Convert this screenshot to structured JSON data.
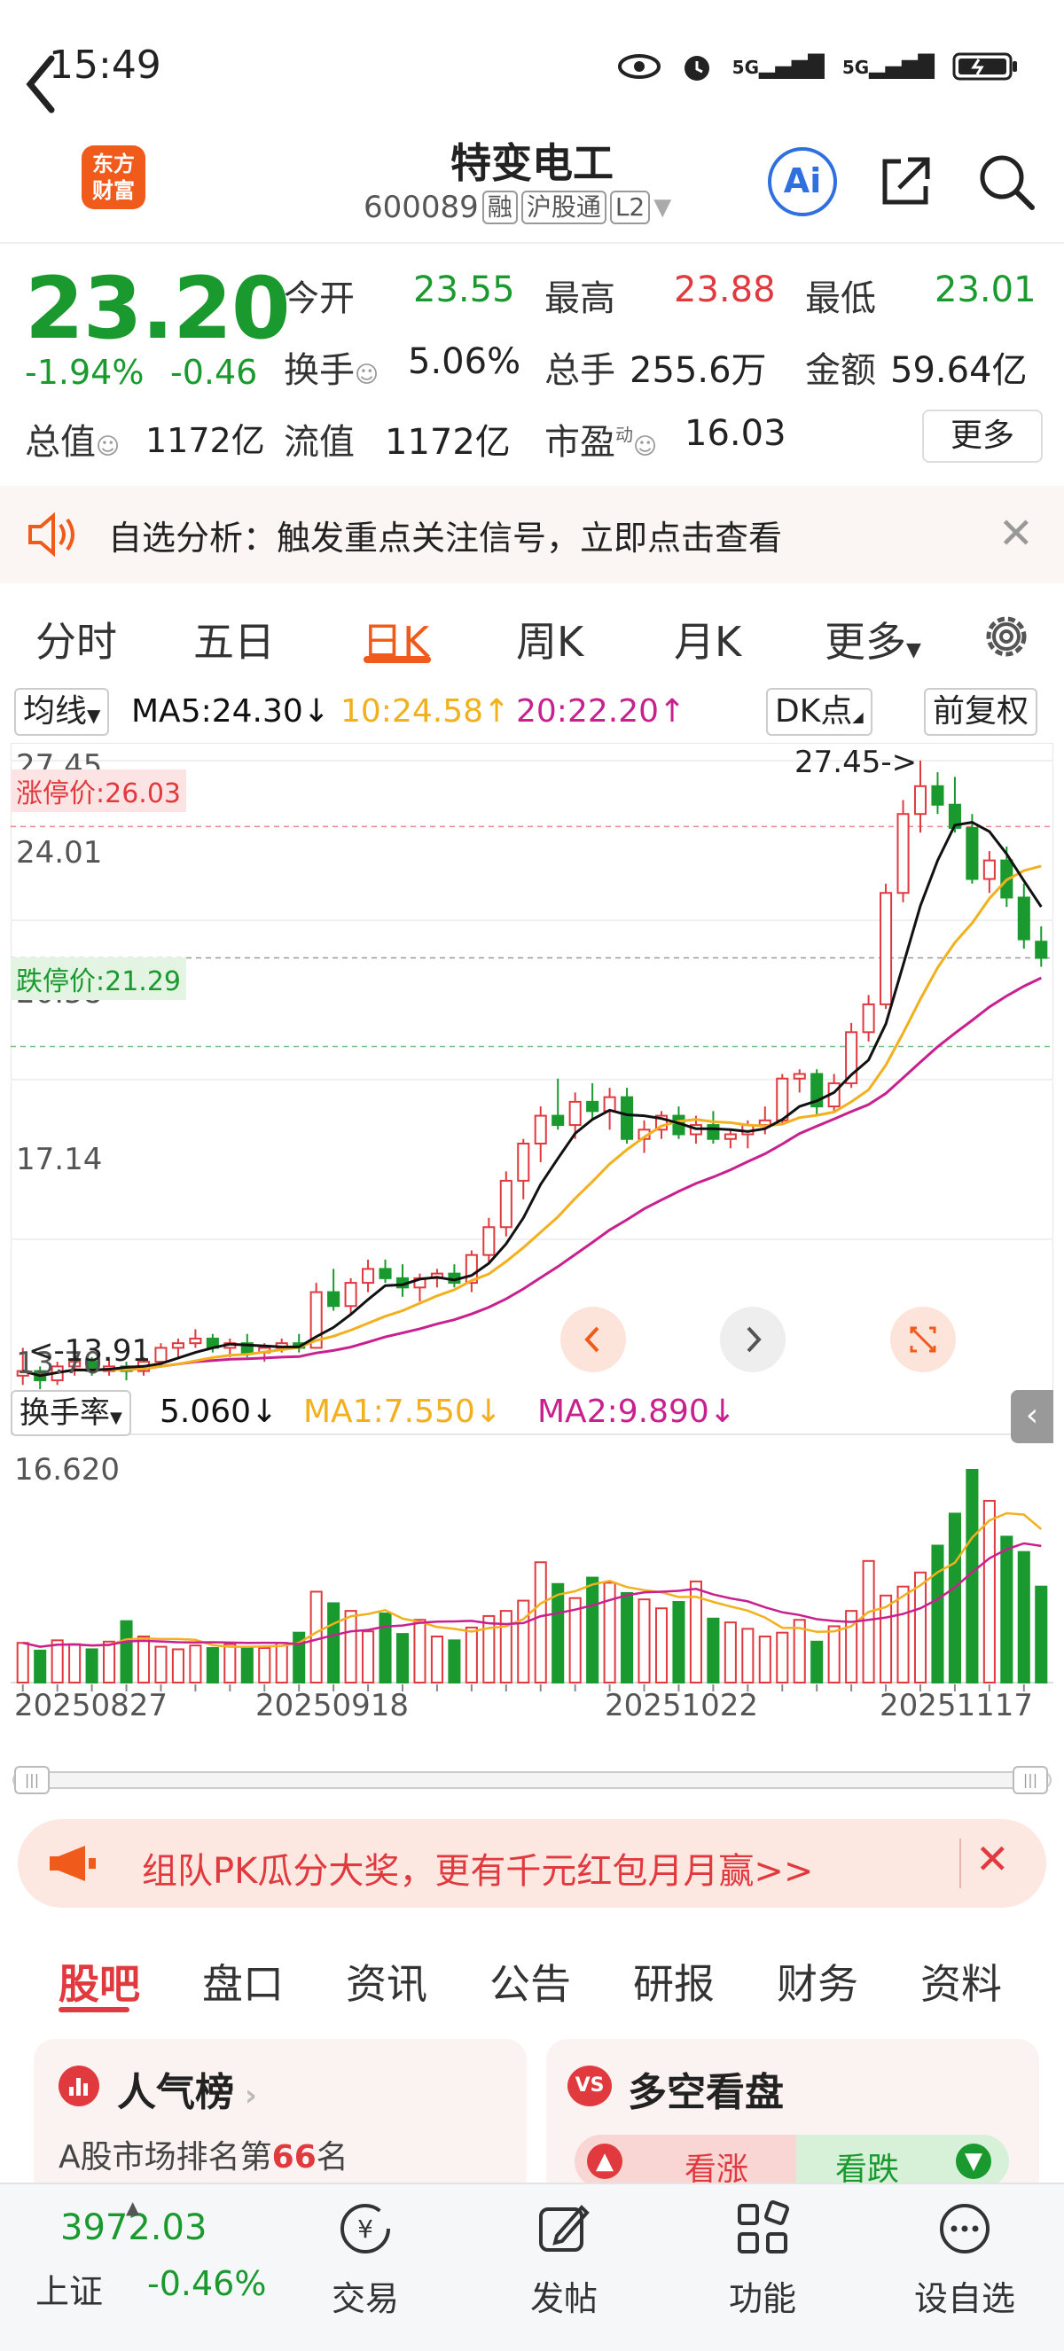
{
  "status_bar": {
    "time": "15:49",
    "net1": "5G",
    "net2": "5G"
  },
  "header": {
    "logo_text_1": "东方",
    "logo_text_2": "财富",
    "stock_name": "特变电工",
    "stock_code": "600089",
    "tags": [
      "融",
      "沪股通",
      "L2"
    ],
    "ai_label": "Ai"
  },
  "quote": {
    "price": "23.20",
    "change_pct": "-1.94%",
    "change": "-0.46",
    "open_label": "今开",
    "open": "23.55",
    "high_label": "最高",
    "high": "23.88",
    "low_label": "最低",
    "low": "23.01",
    "turnover_label": "换手",
    "turnover": "5.06%",
    "volume_label": "总手",
    "volume": "255.6万",
    "amount_label": "金额",
    "amount": "59.64亿",
    "mktcap_label": "总值",
    "mktcap": "1172亿",
    "float_label": "流值",
    "float": "1172亿",
    "pe_label": "市盈",
    "pe_sup": "动",
    "pe": "16.03",
    "more_label": "更多"
  },
  "notice": {
    "text": "自选分析：触发重点关注信号，立即点击查看"
  },
  "chart_tabs": [
    "分时",
    "五日",
    "日K",
    "周K",
    "月K",
    "更多"
  ],
  "ma_row": {
    "ma_select": "均线",
    "ma5": "MA5:24.30↓",
    "ma10": "10:24.58↑",
    "ma20": "20:22.20↑",
    "dk": "DK点",
    "adjust": "前复权"
  },
  "price_axis": [
    "27.45",
    "24.01",
    "20.58",
    "17.14",
    "13.70"
  ],
  "limit_up": "涨停价:26.03",
  "limit_down": "跌停价:21.29",
  "max_annotation": "27.45->",
  "min_annotation": "<-13.91",
  "volume_row": {
    "select": "换手率",
    "value": "5.060↓",
    "ma1": "MA1:7.550↓",
    "ma2": "MA2:9.890↓",
    "max_label": "16.620"
  },
  "date_axis": [
    "20250827",
    "20250918",
    "20251022",
    "20251117"
  ],
  "banner": {
    "text": "组队PK瓜分大奖，更有千元红包月月赢>>"
  },
  "bottom_tabs": [
    "股吧",
    "盘口",
    "资讯",
    "公告",
    "研报",
    "财务",
    "资料"
  ],
  "cards": {
    "left_title": "人气榜",
    "left_sub_pre": "A股市场排名第",
    "left_rank": "66",
    "left_sub_post": "名",
    "right_title": "多空看盘",
    "bull": "看涨",
    "bear": "看跌"
  },
  "bottom_bar": {
    "index_value": "3972.03",
    "index_name": "上证",
    "index_change": "-0.46%",
    "items": [
      "交易",
      "发帖",
      "功能",
      "设自选"
    ]
  },
  "colors": {
    "up": "#e0393e",
    "down": "#1a9a2e",
    "accent": "#f05a1a",
    "ma5": "#111111",
    "ma10": "#f2b01e",
    "ma20": "#c8208f"
  },
  "chart_data": {
    "type": "candlestick",
    "ylim": [
      13.7,
      27.45
    ],
    "candles": [
      [
        14.2,
        14.8,
        14.0,
        14.3
      ],
      [
        14.3,
        14.4,
        13.91,
        14.1
      ],
      [
        14.1,
        14.5,
        14.0,
        14.4
      ],
      [
        14.4,
        14.6,
        14.2,
        14.5
      ],
      [
        14.5,
        14.6,
        14.2,
        14.3
      ],
      [
        14.3,
        14.6,
        14.2,
        14.4
      ],
      [
        14.4,
        14.5,
        14.1,
        14.3
      ],
      [
        14.3,
        14.6,
        14.2,
        14.5
      ],
      [
        14.5,
        14.9,
        14.4,
        14.8
      ],
      [
        14.8,
        15.0,
        14.6,
        14.9
      ],
      [
        14.9,
        15.2,
        14.8,
        15.0
      ],
      [
        15.0,
        15.1,
        14.7,
        14.8
      ],
      [
        14.8,
        15.0,
        14.6,
        14.9
      ],
      [
        14.9,
        15.1,
        14.6,
        14.7
      ],
      [
        14.7,
        14.9,
        14.5,
        14.8
      ],
      [
        14.8,
        15.0,
        14.7,
        14.9
      ],
      [
        14.9,
        15.1,
        14.7,
        14.8
      ],
      [
        14.8,
        16.2,
        14.8,
        16.0
      ],
      [
        16.0,
        16.5,
        15.6,
        15.7
      ],
      [
        15.7,
        16.3,
        15.5,
        16.2
      ],
      [
        16.2,
        16.7,
        16.0,
        16.5
      ],
      [
        16.5,
        16.7,
        16.2,
        16.3
      ],
      [
        16.3,
        16.6,
        15.9,
        16.1
      ],
      [
        16.1,
        16.4,
        15.8,
        16.3
      ],
      [
        16.3,
        16.5,
        16.1,
        16.4
      ],
      [
        16.4,
        16.6,
        16.1,
        16.2
      ],
      [
        16.2,
        16.9,
        16.0,
        16.8
      ],
      [
        16.8,
        17.6,
        16.6,
        17.4
      ],
      [
        17.4,
        18.6,
        17.2,
        18.4
      ],
      [
        18.4,
        19.3,
        18.0,
        19.2
      ],
      [
        19.2,
        20.0,
        18.8,
        19.8
      ],
      [
        19.8,
        20.6,
        19.5,
        19.6
      ],
      [
        19.6,
        20.3,
        19.3,
        20.1
      ],
      [
        20.1,
        20.5,
        19.7,
        19.9
      ],
      [
        19.9,
        20.4,
        19.5,
        20.2
      ],
      [
        20.2,
        20.4,
        19.2,
        19.3
      ],
      [
        19.3,
        19.7,
        19.0,
        19.5
      ],
      [
        19.5,
        19.9,
        19.3,
        19.8
      ],
      [
        19.8,
        20.0,
        19.3,
        19.4
      ],
      [
        19.4,
        19.8,
        19.2,
        19.6
      ],
      [
        19.6,
        19.9,
        19.2,
        19.3
      ],
      [
        19.3,
        19.5,
        19.1,
        19.4
      ],
      [
        19.4,
        19.7,
        19.1,
        19.6
      ],
      [
        19.6,
        20.0,
        19.4,
        19.7
      ],
      [
        19.7,
        20.7,
        19.6,
        20.6
      ],
      [
        20.6,
        20.8,
        20.3,
        20.7
      ],
      [
        20.7,
        20.8,
        19.8,
        20.0
      ],
      [
        20.0,
        20.7,
        19.9,
        20.5
      ],
      [
        20.5,
        21.8,
        20.4,
        21.6
      ],
      [
        21.6,
        22.4,
        21.4,
        22.2
      ],
      [
        22.2,
        24.8,
        22.1,
        24.6
      ],
      [
        24.6,
        26.6,
        24.4,
        26.3
      ],
      [
        26.3,
        27.45,
        25.9,
        26.9
      ],
      [
        26.9,
        27.2,
        26.3,
        26.5
      ],
      [
        26.5,
        27.1,
        25.9,
        26.0
      ],
      [
        26.0,
        26.3,
        24.8,
        24.9
      ],
      [
        24.9,
        25.5,
        24.6,
        25.3
      ],
      [
        25.3,
        25.6,
        24.3,
        24.5
      ],
      [
        24.5,
        24.8,
        23.4,
        23.6
      ],
      [
        23.55,
        23.88,
        23.01,
        23.2
      ]
    ],
    "turnover": [
      3.1,
      2.5,
      3.3,
      3.0,
      2.6,
      3.2,
      4.8,
      3.6,
      2.8,
      2.6,
      2.9,
      2.7,
      3.0,
      2.8,
      2.7,
      3.1,
      3.9,
      7.1,
      6.2,
      5.6,
      4.0,
      5.4,
      3.8,
      4.9,
      3.6,
      3.3,
      4.3,
      5.2,
      5.6,
      6.4,
      9.4,
      7.7,
      6.6,
      8.2,
      7.8,
      7.0,
      6.5,
      5.8,
      6.3,
      7.9,
      5.0,
      4.7,
      4.2,
      3.6,
      3.9,
      4.9,
      3.2,
      4.4,
      5.6,
      9.5,
      6.8,
      7.5,
      8.6,
      10.7,
      13.2,
      16.62,
      14.2,
      11.4,
      10.2,
      7.5
    ],
    "dates": [
      "20250827",
      "20250918",
      "20251022",
      "20251117"
    ]
  }
}
